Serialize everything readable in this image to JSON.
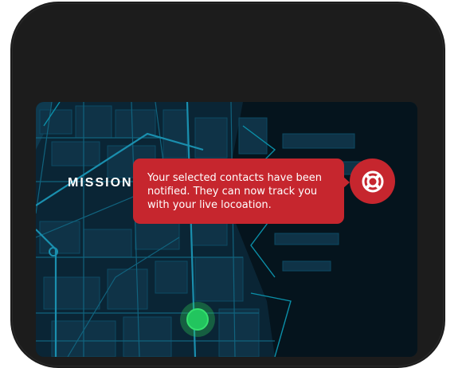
{
  "map": {
    "district_label": "MISSION"
  },
  "notification": {
    "message": "Your selected contacts have been notified. They can now track you with your live locoation."
  },
  "icons": {
    "sos_button": "lifebuoy-icon",
    "location_marker": "location-dot-icon"
  },
  "colors": {
    "alert_red": "#c6262e",
    "map_background": "#071d2a",
    "marker_green": "#22c55e",
    "phone_body": "#1c1c1c"
  }
}
